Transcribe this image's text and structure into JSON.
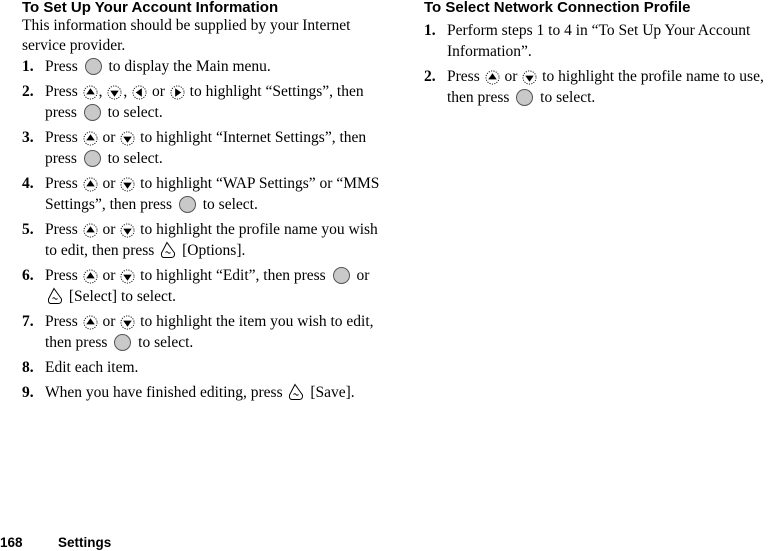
{
  "left_section": {
    "title": "To Set Up Your Account Information",
    "intro": "This information should be supplied by your Internet service provider.",
    "steps": [
      {
        "num": "1.",
        "parts": [
          "Press",
          "center-key",
          "to display the Main menu."
        ]
      },
      {
        "num": "2.",
        "parts": [
          "Press",
          "nav-up-key",
          ",",
          "nav-down-key",
          ",",
          "nav-left-key",
          "or",
          "nav-right-key",
          "to highlight “Settings”, then press",
          "center-key",
          "to select."
        ]
      },
      {
        "num": "3.",
        "parts": [
          "Press",
          "nav-up-key",
          "or",
          "nav-down-key",
          "to highlight “Internet Settings”, then press",
          "center-key",
          "to select."
        ]
      },
      {
        "num": "4.",
        "parts": [
          "Press",
          "nav-up-key",
          "or",
          "nav-down-key",
          "to highlight “WAP Settings” or “MMS Settings”, then press",
          "center-key",
          "to select."
        ]
      },
      {
        "num": "5.",
        "parts": [
          "Press",
          "nav-up-key",
          "or",
          "nav-down-key",
          "to highlight the profile name you wish to edit, then press",
          "soft-key",
          "[Options]."
        ]
      },
      {
        "num": "6.",
        "parts": [
          "Press",
          "nav-up-key",
          "or",
          "nav-down-key",
          "to highlight “Edit”, then press",
          "center-key",
          "or",
          "soft-key",
          "[Select] to select."
        ]
      },
      {
        "num": "7.",
        "parts": [
          "Press",
          "nav-up-key",
          "or",
          "nav-down-key",
          "to highlight the item you wish to edit, then press",
          "center-key",
          "to select."
        ]
      },
      {
        "num": "8.",
        "parts": [
          "Edit each item."
        ]
      },
      {
        "num": "9.",
        "parts": [
          "When you have finished editing, press",
          "soft-key",
          "[Save]."
        ]
      }
    ]
  },
  "right_section": {
    "title": "To Select Network Connection Profile",
    "steps": [
      {
        "num": "1.",
        "parts": [
          "Perform steps 1 to 4 in “To Set Up Your Account Information”."
        ]
      },
      {
        "num": "2.",
        "parts": [
          "Press",
          "nav-up-key",
          "or",
          "nav-down-key",
          "to highlight the profile name to use, then press",
          "center-key",
          "to select."
        ]
      }
    ]
  },
  "footer": {
    "page_number": "168",
    "section_name": "Settings"
  }
}
